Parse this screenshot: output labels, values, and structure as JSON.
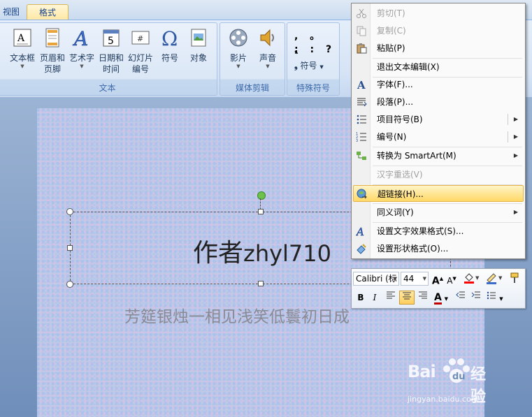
{
  "tabs": {
    "view": "视图",
    "format": "格式"
  },
  "ribbon": {
    "group_text": {
      "title": "文本",
      "items": [
        {
          "l1": "文本框",
          "l2": "",
          "arrow": true
        },
        {
          "l1": "页眉和",
          "l2": "页脚",
          "arrow": false
        },
        {
          "l1": "艺术字",
          "l2": "",
          "arrow": true
        },
        {
          "l1": "日期和",
          "l2": "时间",
          "arrow": false
        },
        {
          "l1": "幻灯片",
          "l2": "编号",
          "arrow": false
        },
        {
          "l1": "符号",
          "l2": "",
          "arrow": false
        },
        {
          "l1": "对象",
          "l2": "",
          "arrow": false
        }
      ],
      "date_icon_number": "5",
      "slide_icon_mark": "#"
    },
    "group_media": {
      "title": "媒体剪辑",
      "items": [
        {
          "l1": "影片"
        },
        {
          "l1": "声音"
        }
      ]
    },
    "group_special": {
      "title": "特殊符号",
      "row1": ",  。 、",
      "row2": ";  :  ?",
      "symbol_label": "符号"
    }
  },
  "slide": {
    "title_cjk": "作者",
    "title_latin": "zhyl710",
    "subtitle": "芳筵银烛一相见浅笑低鬟初日成"
  },
  "context_menu": {
    "items": [
      {
        "label": "剪切(T)",
        "icon": "scissors-icon",
        "disabled": true
      },
      {
        "label": "复制(C)",
        "icon": "copy-icon",
        "disabled": true
      },
      {
        "label": "粘贴(P)",
        "icon": "paste-icon",
        "disabled": false
      },
      {
        "label": "退出文本编辑(X)",
        "icon": "",
        "disabled": false
      },
      {
        "label": "字体(F)...",
        "icon": "font-icon",
        "disabled": false
      },
      {
        "label": "段落(P)...",
        "icon": "paragraph-icon",
        "disabled": false
      },
      {
        "label": "项目符号(B)",
        "icon": "bullets-icon",
        "disabled": false,
        "submenu": true
      },
      {
        "label": "编号(N)",
        "icon": "numbering-icon",
        "disabled": false,
        "submenu": true
      },
      {
        "label": "转换为 SmartArt(M)",
        "icon": "smartart-icon",
        "disabled": false,
        "submenu": true
      },
      {
        "label": "汉字重选(V)",
        "icon": "",
        "disabled": true
      },
      {
        "label": "超链接(H)...",
        "icon": "hyperlink-icon",
        "disabled": false,
        "highlighted": true
      },
      {
        "label": "同义词(Y)",
        "icon": "",
        "disabled": false,
        "submenu": true
      },
      {
        "label": "设置文字效果格式(S)...",
        "icon": "text-effects-icon",
        "disabled": false
      },
      {
        "label": "设置形状格式(O)...",
        "icon": "shape-format-icon",
        "disabled": false
      }
    ]
  },
  "mini_toolbar": {
    "font_name": "Calibri (标",
    "font_size": "44",
    "bold": "B",
    "italic": "I",
    "grow_font": "A",
    "shrink_font": "A",
    "font_color_letter": "A"
  },
  "watermark": {
    "brand": "Bai",
    "brand2": "经验",
    "url": "jingyan.baidu.com"
  },
  "colors": {
    "accent": "#15428b",
    "highlight": "#ffd866",
    "font_color": "#c00000"
  }
}
